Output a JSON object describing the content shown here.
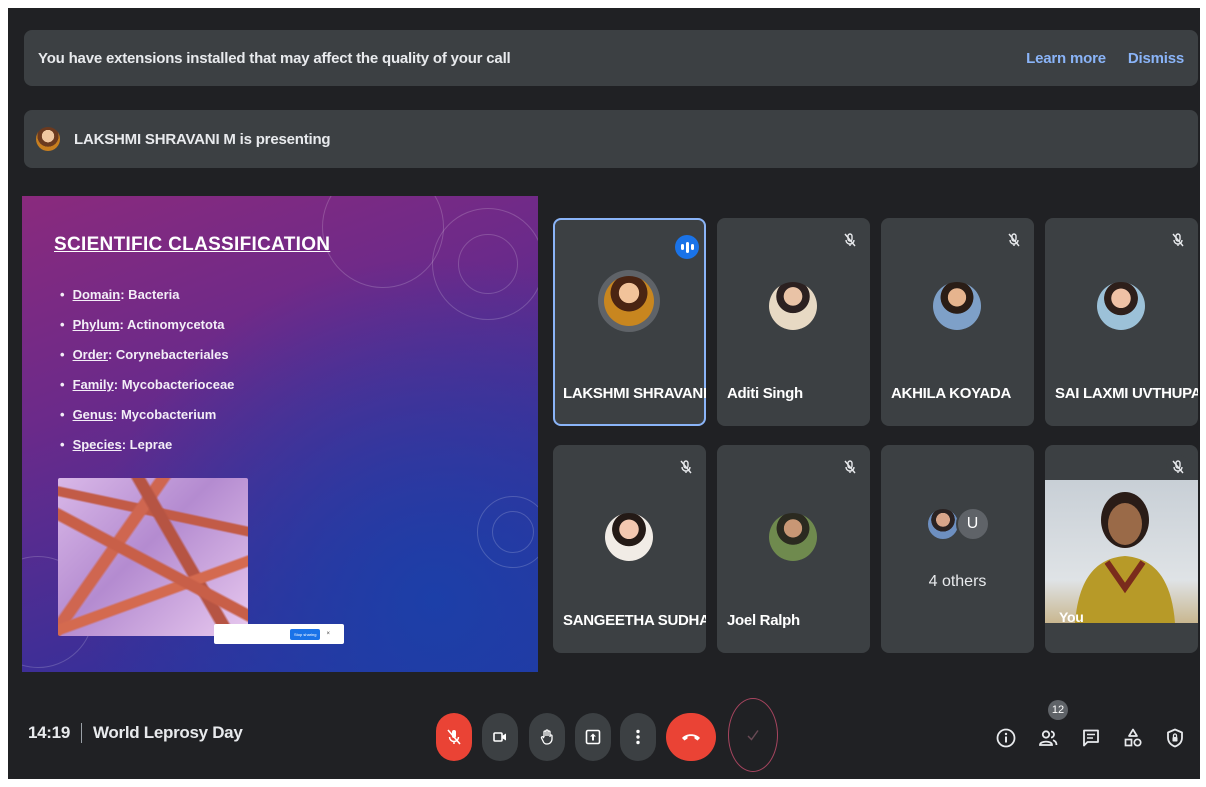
{
  "banner": {
    "message": "You have extensions installed that may affect the quality of your call",
    "learn_more": "Learn more",
    "dismiss": "Dismiss"
  },
  "presenting": {
    "text": "LAKSHMI SHRAVANI M is presenting"
  },
  "slide": {
    "title": "SCIENTIFIC CLASSIFICATION",
    "items": [
      {
        "key": "Domain",
        "value": ": Bacteria"
      },
      {
        "key": "Phylum",
        "value": ": Actinomycetota"
      },
      {
        "key": "Order",
        "value": ": Corynebacteriales"
      },
      {
        "key": "Family",
        "value": ": Mycobacterioceae"
      },
      {
        "key": "Genus",
        "value": ": Mycobacterium"
      },
      {
        "key": "Species",
        "value": ": Leprae"
      }
    ],
    "share_bar": {
      "stop_label": "Stop sharing",
      "hide_label": "×"
    }
  },
  "participants": [
    {
      "name": "LAKSHMI SHRAVANI M",
      "state": "speaking"
    },
    {
      "name": "Aditi Singh",
      "state": "muted"
    },
    {
      "name": "AKHILA KOYADA",
      "state": "muted"
    },
    {
      "name": "SAI LAXMI UVTHUPA...",
      "state": "muted"
    },
    {
      "name": "SANGEETHA SUDHA ...",
      "state": "muted"
    },
    {
      "name": "Joel Ralph",
      "state": "muted"
    }
  ],
  "others": {
    "initial": "U",
    "label": "4 others"
  },
  "self_tile": {
    "label": "You"
  },
  "footer": {
    "time": "14:19",
    "meeting_title": "World Leprosy Day",
    "participant_count": "12"
  },
  "colors": {
    "background": "#202124",
    "tile": "#3c4043",
    "accent": "#8ab4f8",
    "danger": "#ea4335",
    "speaking": "#1a73e8"
  },
  "icons": [
    "mic-off-icon",
    "camera-icon",
    "raise-hand-icon",
    "present-icon",
    "more-options-icon",
    "end-call-icon",
    "info-icon",
    "people-icon",
    "chat-icon",
    "activities-icon",
    "host-controls-icon"
  ]
}
